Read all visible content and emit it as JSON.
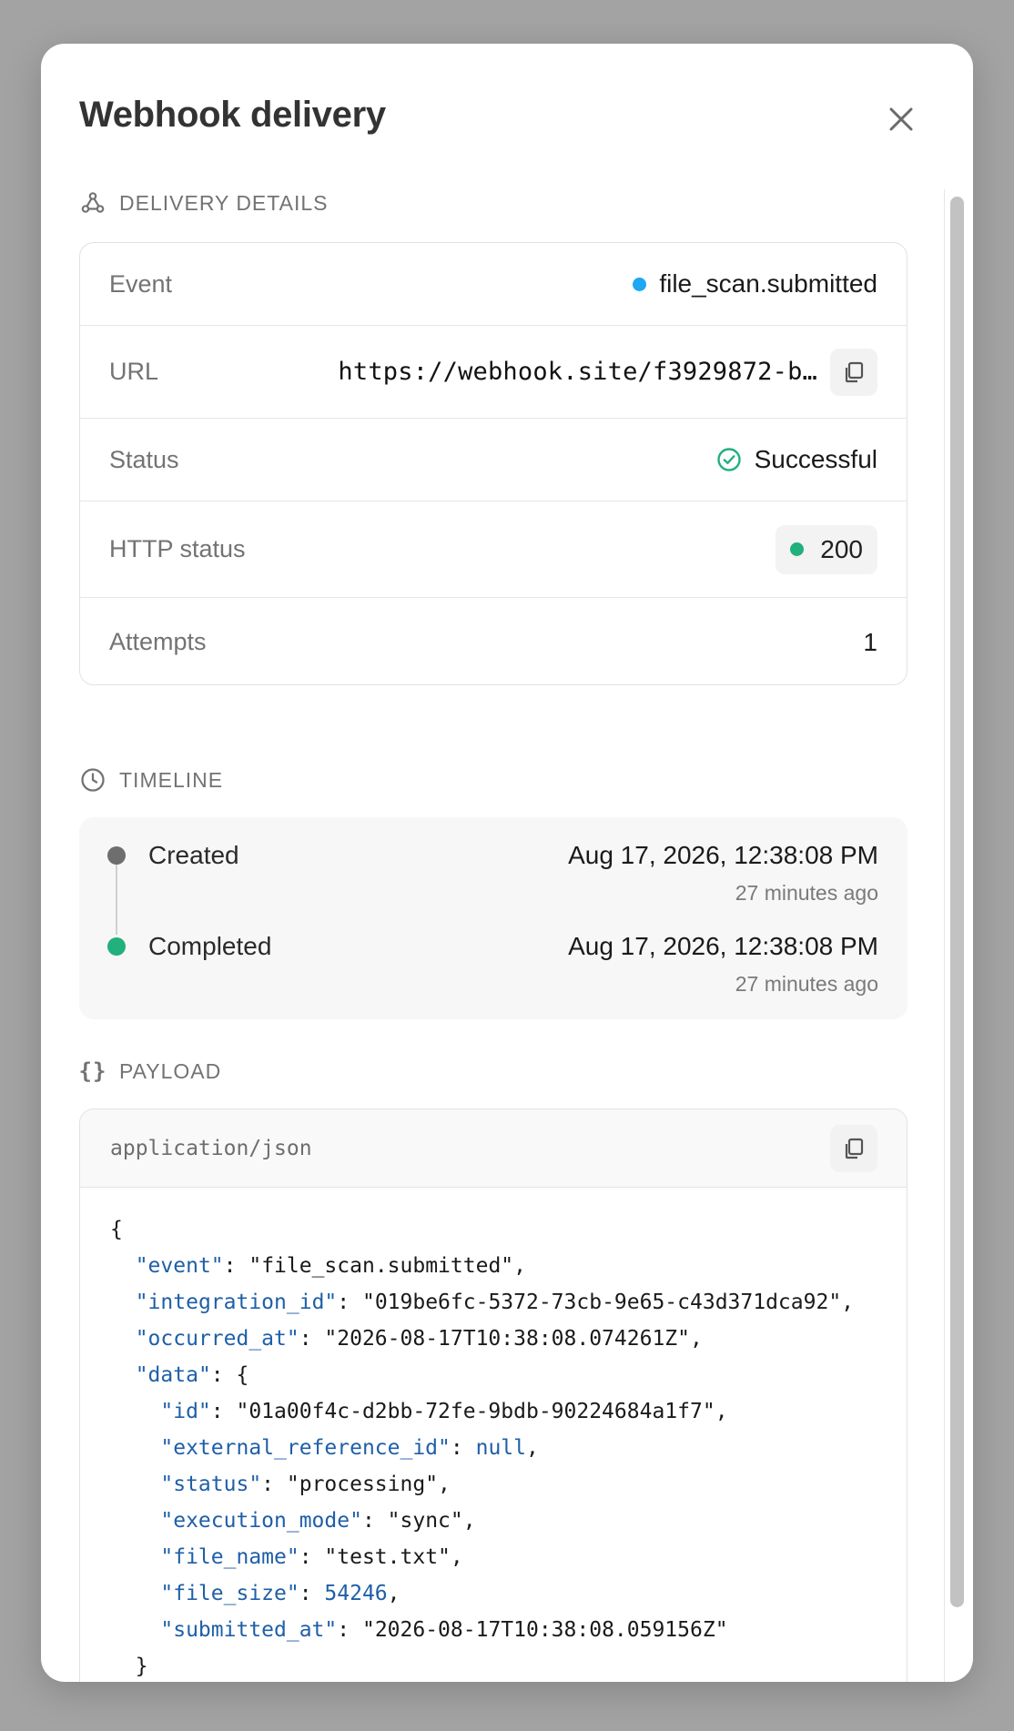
{
  "modal": {
    "title": "Webhook delivery"
  },
  "sections": {
    "details": "DELIVERY DETAILS",
    "timeline": "TIMELINE",
    "payload": "PAYLOAD"
  },
  "details": {
    "event": {
      "label": "Event",
      "value": "file_scan.submitted"
    },
    "url": {
      "label": "URL",
      "value": "https://webhook.site/f3929872-b…"
    },
    "status": {
      "label": "Status",
      "value": "Successful"
    },
    "http_status": {
      "label": "HTTP status",
      "value": "200"
    },
    "attempts": {
      "label": "Attempts",
      "value": "1"
    }
  },
  "timeline": {
    "items": [
      {
        "label": "Created",
        "date": "Aug 17, 2026, 12:38:08 PM",
        "relative": "27 minutes ago"
      },
      {
        "label": "Completed",
        "date": "Aug 17, 2026, 12:38:08 PM",
        "relative": "27 minutes ago"
      }
    ]
  },
  "payload": {
    "content_type": "application/json",
    "json": {
      "open": "{",
      "close": "}",
      "data_close": "}",
      "event": {
        "key": "\"event\"",
        "value": "\"file_scan.submitted\""
      },
      "integration_id": {
        "key": "\"integration_id\"",
        "value": "\"019be6fc-5372-73cb-9e65-c43d371dca92\""
      },
      "occurred_at": {
        "key": "\"occurred_at\"",
        "value": "\"2026-08-17T10:38:08.074261Z\""
      },
      "data": {
        "key": "\"data\"",
        "value": "{"
      },
      "id": {
        "key": "\"id\"",
        "value": "\"01a00f4c-d2bb-72fe-9bdb-90224684a1f7\""
      },
      "external_reference_id": {
        "key": "\"external_reference_id\"",
        "value": "null"
      },
      "status": {
        "key": "\"status\"",
        "value": "\"processing\""
      },
      "execution_mode": {
        "key": "\"execution_mode\"",
        "value": "\"sync\""
      },
      "file_name": {
        "key": "\"file_name\"",
        "value": "\"test.txt\""
      },
      "file_size": {
        "key": "\"file_size\"",
        "value": "54246"
      },
      "submitted_at": {
        "key": "\"submitted_at\"",
        "value": "\"2026-08-17T10:38:08.059156Z\""
      }
    }
  },
  "colors": {
    "event_dot": "#1ea7f2",
    "success": "#22b07d",
    "created_dot": "#6e6e6e",
    "json_key": "#1f5fa8"
  },
  "icons": {
    "close": "close-icon",
    "details": "webhook-icon",
    "copy": "copy-icon",
    "status": "check-circle-icon",
    "timeline": "clock-icon",
    "payload": "braces-icon"
  }
}
